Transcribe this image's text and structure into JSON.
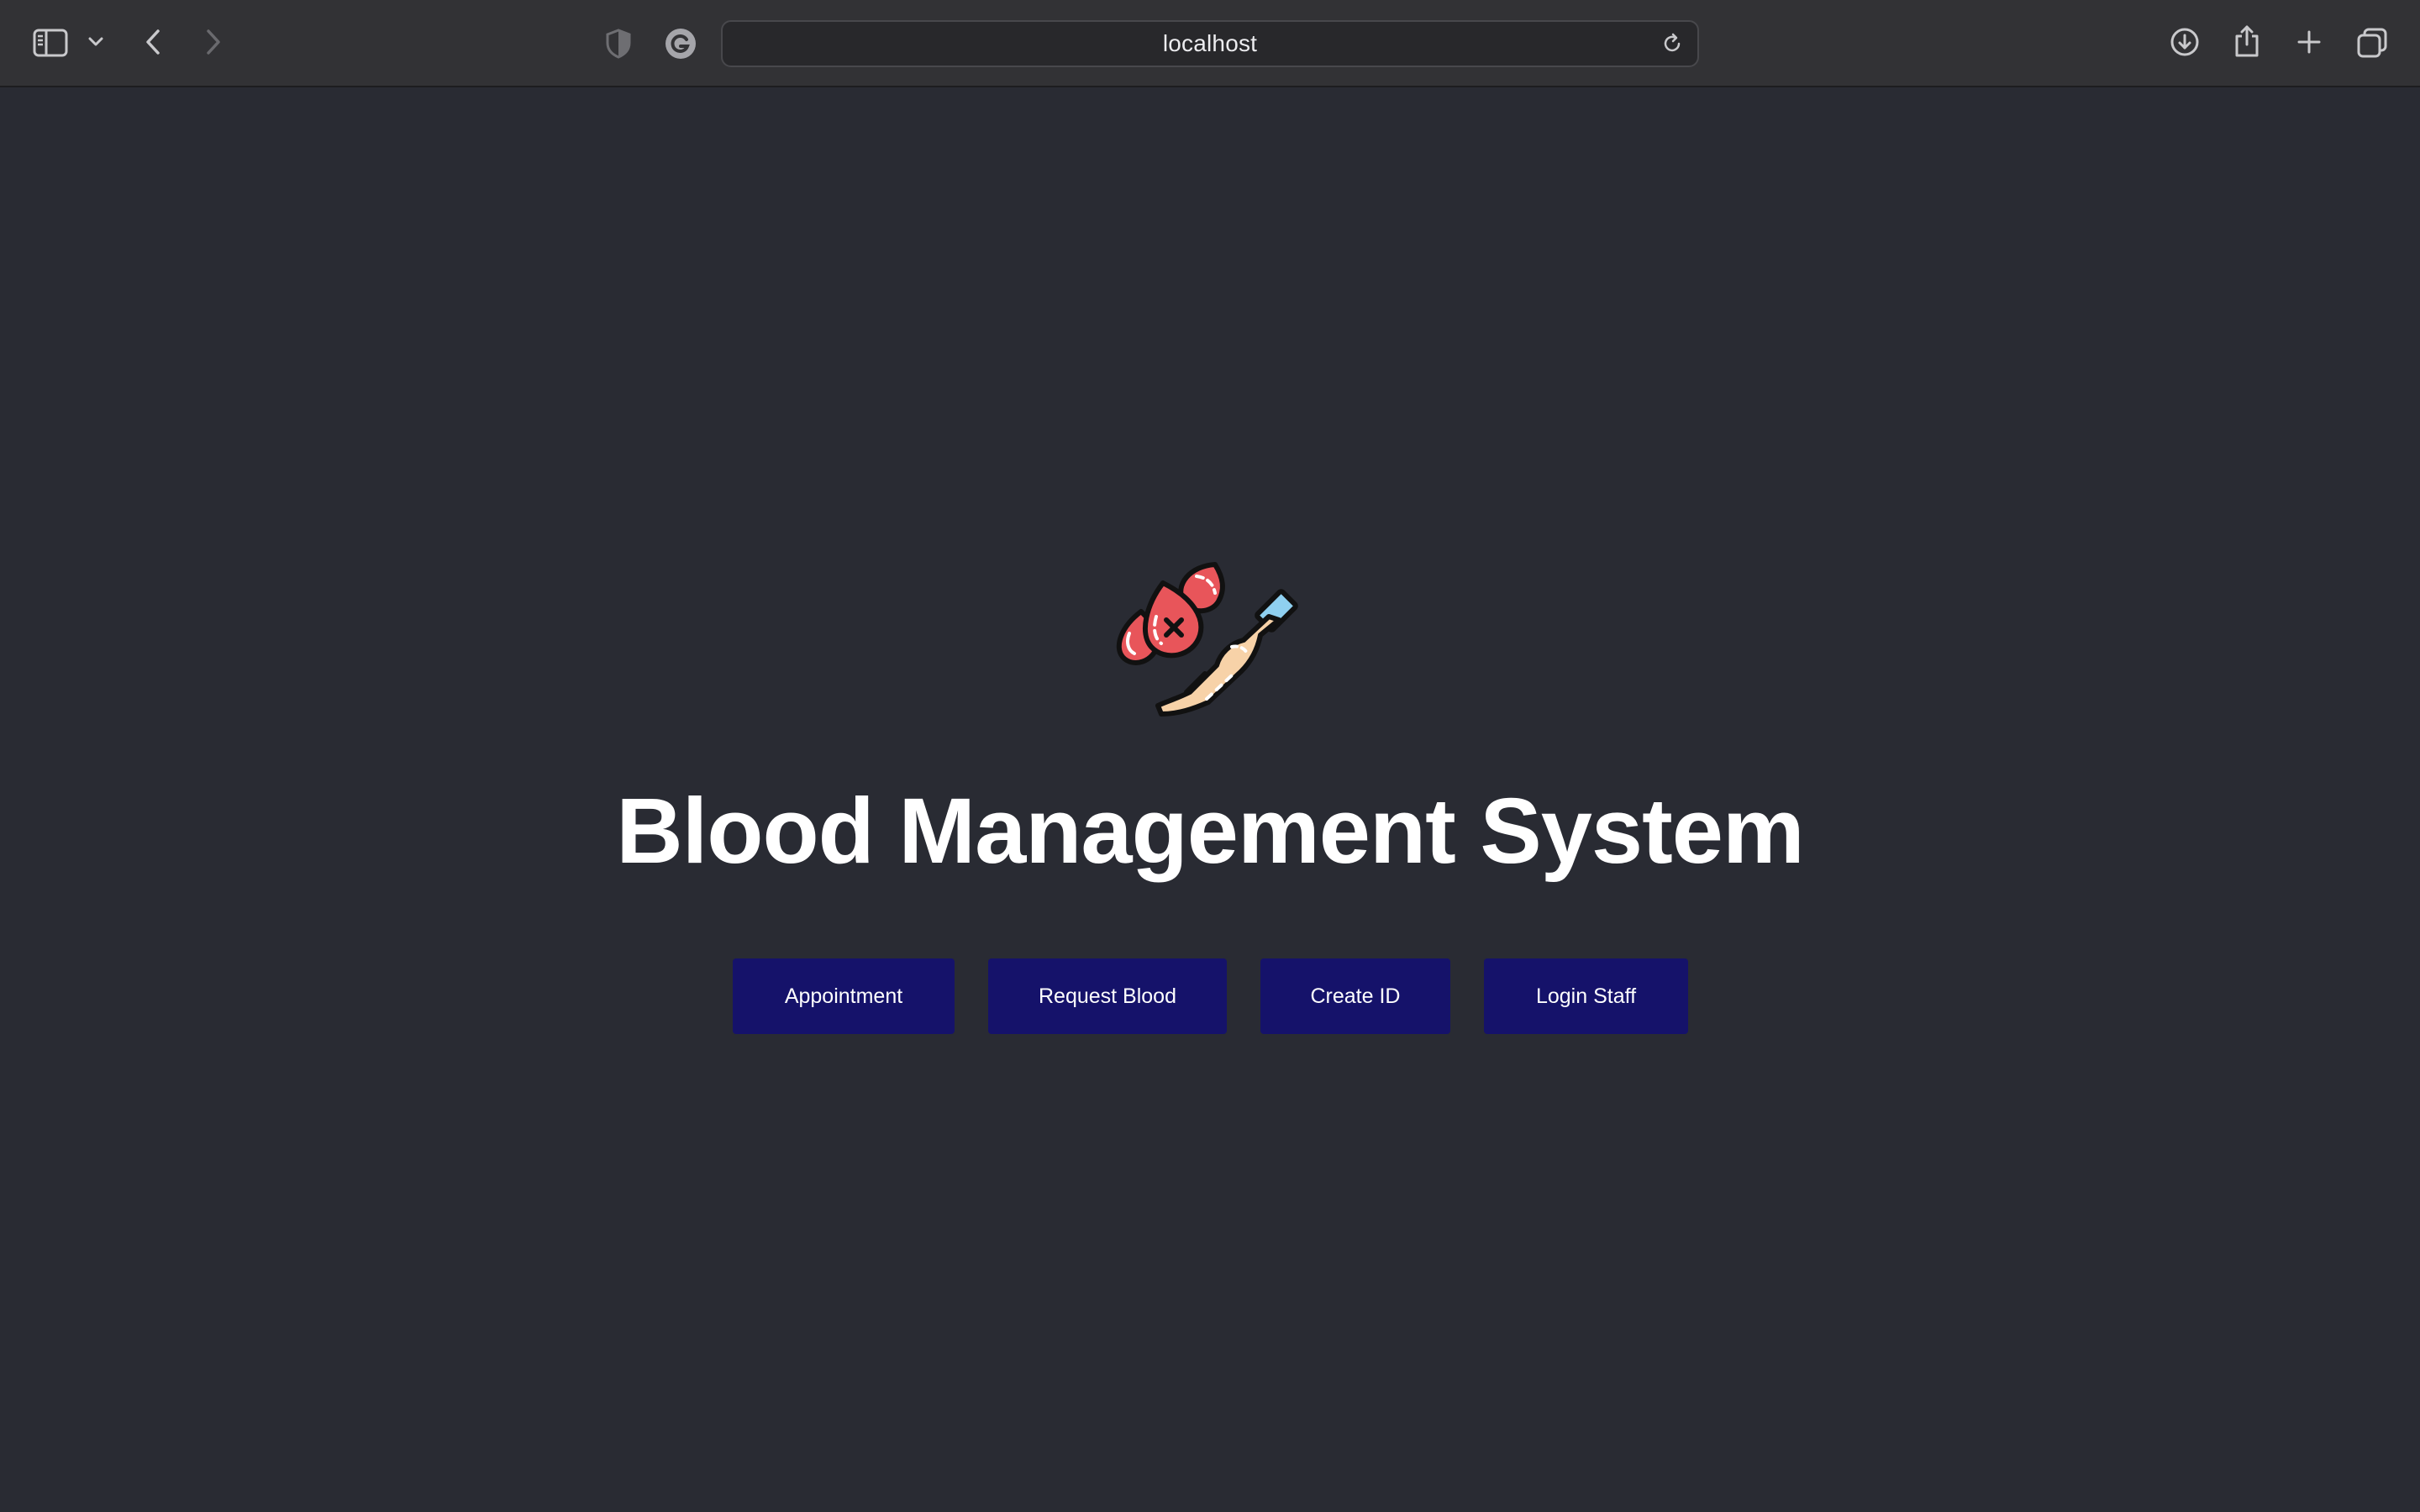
{
  "browser": {
    "url": "localhost",
    "icons": {
      "sidebar": "sidebar-icon",
      "sidebar_menu": "chevron-down-icon",
      "back": "chevron-left-icon",
      "forward": "chevron-right-icon",
      "privacy": "shield-icon",
      "extension": "grammarly-icon",
      "reload": "reload-icon",
      "downloads": "download-icon",
      "share": "share-icon",
      "new_tab": "plus-icon",
      "tab_overview": "tabs-icon"
    }
  },
  "page": {
    "title": "Blood Management System",
    "illustration": "blood-donation-icon",
    "buttons": [
      {
        "label": "Appointment"
      },
      {
        "label": "Request Blood"
      },
      {
        "label": "Create ID"
      },
      {
        "label": "Login Staff"
      }
    ]
  },
  "colors": {
    "background": "#292b33",
    "toolbar": "#323235",
    "button": "#15126a",
    "title": "#ffffff",
    "blood": "#e8555a",
    "skin": "#f7d2a8"
  }
}
